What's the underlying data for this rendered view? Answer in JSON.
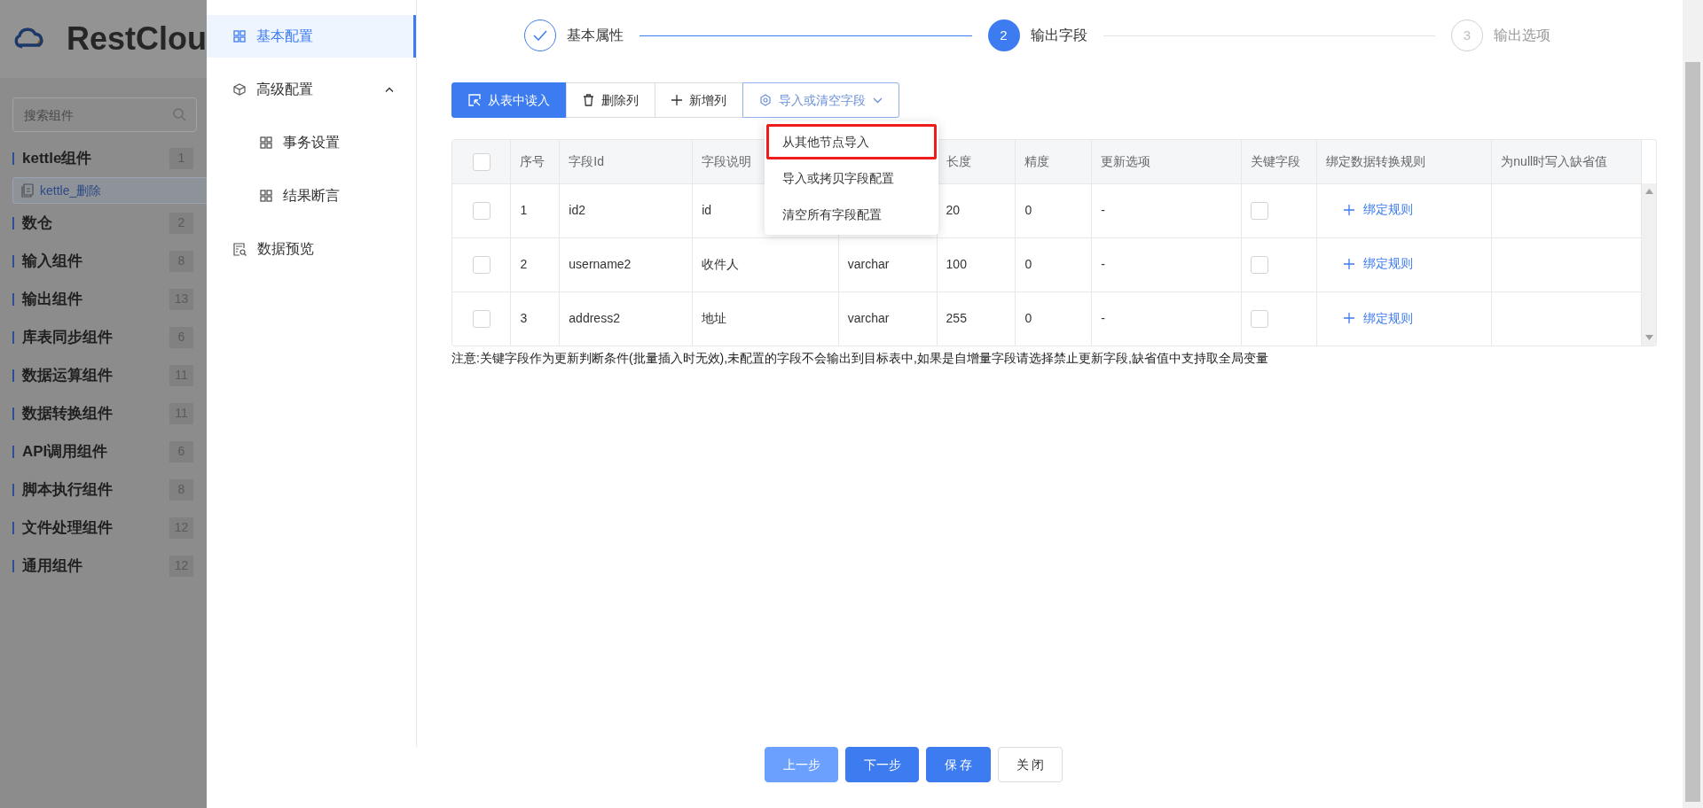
{
  "background_page": {
    "logo_text": "RestClou",
    "search": {
      "placeholder": "搜索组件"
    },
    "categories": [
      {
        "label": "kettle组件",
        "count": "1",
        "children": [
          {
            "label": "kettle_删除"
          }
        ]
      },
      {
        "label": "数仓",
        "count": "2"
      },
      {
        "label": "输入组件",
        "count": "8"
      },
      {
        "label": "输出组件",
        "count": "13"
      },
      {
        "label": "库表同步组件",
        "count": "6"
      },
      {
        "label": "数据运算组件",
        "count": "11"
      },
      {
        "label": "数据转换组件",
        "count": "11"
      },
      {
        "label": "API调用组件",
        "count": "6"
      },
      {
        "label": "脚本执行组件",
        "count": "8"
      },
      {
        "label": "文件处理组件",
        "count": "12"
      },
      {
        "label": "通用组件",
        "count": "12"
      }
    ]
  },
  "drawer": {
    "menu": [
      {
        "label": "基本配置",
        "selected": true
      },
      {
        "label": "高级配置",
        "selected": false,
        "expanded": true,
        "children": [
          {
            "label": "事务设置",
            "selected": false
          },
          {
            "label": "结果断言",
            "selected": false
          }
        ]
      },
      {
        "label": "数据预览",
        "selected": false
      }
    ],
    "steps": [
      {
        "label": "基本属性",
        "completed": true,
        "selected": false
      },
      {
        "number": "2",
        "label": "输出字段",
        "completed": false,
        "selected": true
      },
      {
        "number": "3",
        "label": "输出选项",
        "completed": false,
        "selected": false
      }
    ],
    "toolbar": [
      {
        "label": "从表中读入",
        "kind": "primary"
      },
      {
        "label": "删除列",
        "kind": "default"
      },
      {
        "label": "新增列",
        "kind": "default"
      },
      {
        "label": "导入或清空字段",
        "kind": "dropdown",
        "expanded": true
      }
    ],
    "dropdown_menu": [
      {
        "label": "从其他节点导入",
        "highlighted": true
      },
      {
        "label": "导入或拷贝字段配置",
        "highlighted": false
      },
      {
        "label": "清空所有字段配置",
        "highlighted": false
      }
    ],
    "table": {
      "all_selected": false,
      "columns": [
        {
          "label": "序号"
        },
        {
          "label": "字段Id"
        },
        {
          "label": "字段说明"
        },
        {},
        {
          "label": "长度"
        },
        {
          "label": "精度"
        },
        {
          "label": "更新选项"
        },
        {
          "label": "关键字段"
        },
        {
          "label": "绑定数据转换规则"
        },
        {
          "label": "为null时写入缺省值"
        }
      ],
      "rows": [
        {
          "selected": false,
          "cells": [
            "1",
            "id2",
            "id",
            null,
            "20",
            "0",
            "-"
          ],
          "key_field": false,
          "rule_link": "绑定规则"
        },
        {
          "selected": false,
          "cells": [
            "2",
            "username2",
            "收件人",
            "varchar",
            "100",
            "0",
            "-"
          ],
          "key_field": false,
          "rule_link": "绑定规则"
        },
        {
          "selected": false,
          "cells": [
            "3",
            "address2",
            "地址",
            "varchar",
            "255",
            "0",
            "-"
          ],
          "key_field": false,
          "rule_link": "绑定规则"
        }
      ]
    },
    "note": "注意:关键字段作为更新判断条件(批量插入时无效),未配置的字段不会输出到目标表中,如果是自增量字段请选择禁止更新字段,缺省值中支持取全局变量",
    "footer_buttons": [
      {
        "label": "上一步",
        "kind": "primary",
        "disabled": true
      },
      {
        "label": "下一步",
        "kind": "primary",
        "disabled": false
      },
      {
        "label": "保 存",
        "kind": "primary",
        "disabled": false
      },
      {
        "label": "关 闭",
        "kind": "default"
      }
    ]
  }
}
